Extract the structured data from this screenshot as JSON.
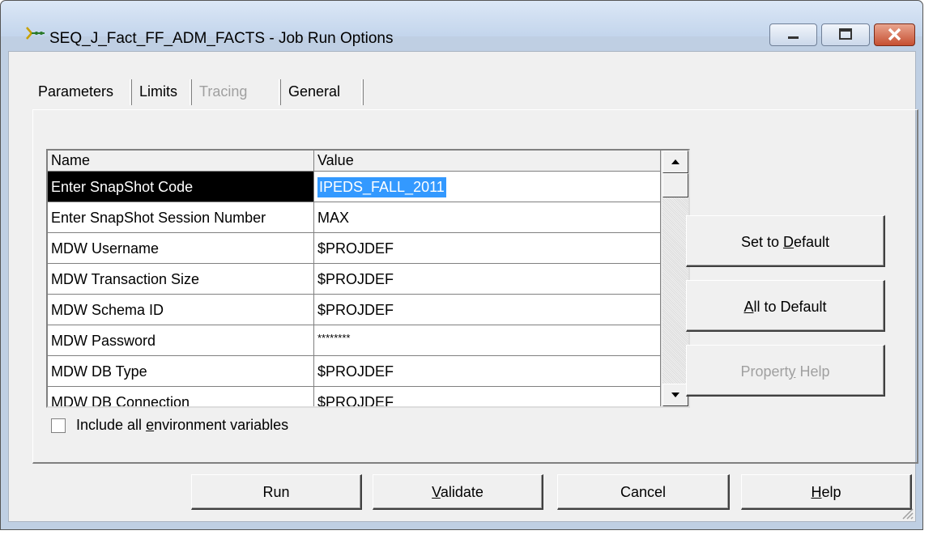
{
  "window": {
    "title": "SEQ_J_Fact_FF_ADM_FACTS - Job Run Options",
    "icon": "job-sequence-icon"
  },
  "tabs": [
    {
      "label": "Parameters",
      "active": true,
      "enabled": true
    },
    {
      "label": "Limits",
      "active": false,
      "enabled": true
    },
    {
      "label": "Tracing",
      "active": false,
      "enabled": false
    },
    {
      "label": "General",
      "active": false,
      "enabled": true
    }
  ],
  "grid": {
    "columns": [
      "Name",
      "Value"
    ],
    "rows": [
      {
        "name": "Enter SnapShot Code",
        "value": "IPEDS_FALL_2011"
      },
      {
        "name": "Enter SnapShot Session Number",
        "value": "MAX"
      },
      {
        "name": "MDW Username",
        "value": "$PROJDEF"
      },
      {
        "name": "MDW Transaction Size",
        "value": "$PROJDEF"
      },
      {
        "name": "MDW Schema ID",
        "value": "$PROJDEF"
      },
      {
        "name": "MDW Password",
        "value": "********"
      },
      {
        "name": "MDW DB Type",
        "value": "$PROJDEF"
      },
      {
        "name": "MDW DB Connection",
        "value": "$PROJDEF"
      }
    ],
    "selected_row": 0
  },
  "side_buttons": {
    "set_default": {
      "pre": "Set to ",
      "key": "D",
      "post": "efault"
    },
    "all_default": {
      "pre": "",
      "key": "A",
      "post": "ll to Default"
    },
    "property_help": {
      "pre": "Propert",
      "key": "y",
      "post": " Help"
    }
  },
  "checkbox": {
    "pre": "Include all ",
    "key": "e",
    "post": "nvironment variables",
    "checked": false
  },
  "bottom_buttons": {
    "run": {
      "pre": "Run",
      "key": "",
      "post": ""
    },
    "validate": {
      "pre": "",
      "key": "V",
      "post": "alidate"
    },
    "cancel": {
      "pre": "Cancel",
      "key": "",
      "post": ""
    },
    "help": {
      "pre": "",
      "key": "H",
      "post": "elp"
    }
  },
  "colors": {
    "selection": "#3399ff",
    "selected_name_bg": "#000000",
    "close_button": "#c64f31"
  }
}
